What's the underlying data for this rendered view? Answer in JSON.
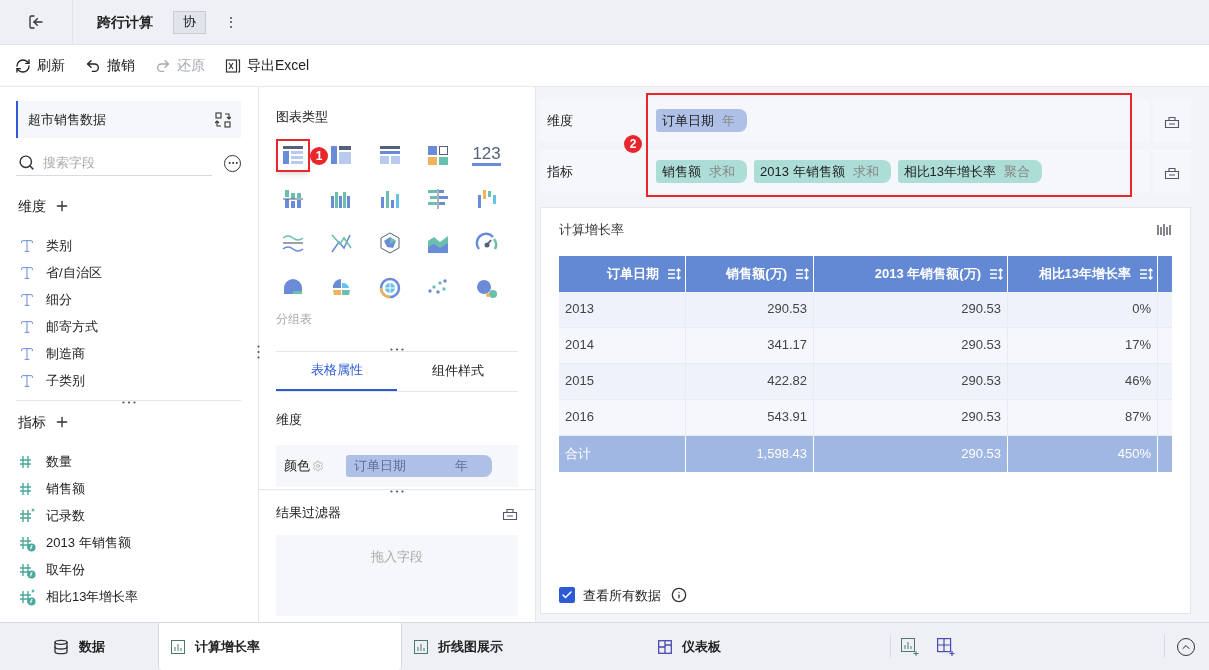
{
  "header": {
    "title": "跨行计算",
    "badge": "协",
    "more": "⋮"
  },
  "toolbar": [
    {
      "label": "刷新",
      "kind": "refresh",
      "disabled": false
    },
    {
      "label": "撤销",
      "kind": "undo",
      "disabled": false
    },
    {
      "label": "还原",
      "kind": "redo",
      "disabled": true
    },
    {
      "label": "导出Excel",
      "kind": "excel",
      "disabled": false
    }
  ],
  "dataset": {
    "name": "超市销售数据",
    "search_placeholder": "搜索字段"
  },
  "dimensions": {
    "title": "维度",
    "fields": [
      {
        "name": "类别",
        "kind": "text"
      },
      {
        "name": "省/自治区",
        "kind": "text"
      },
      {
        "name": "细分",
        "kind": "text"
      },
      {
        "name": "邮寄方式",
        "kind": "text"
      },
      {
        "name": "制造商",
        "kind": "text"
      },
      {
        "name": "子类别",
        "kind": "text"
      }
    ]
  },
  "measures": {
    "title": "指标",
    "fields": [
      {
        "name": "数量",
        "kind": "number"
      },
      {
        "name": "销售额",
        "kind": "number"
      },
      {
        "name": "记录数",
        "kind": "record"
      },
      {
        "name": "2013 年销售额",
        "kind": "calc"
      },
      {
        "name": "取年份",
        "kind": "calc"
      },
      {
        "name": "相比13年增长率",
        "kind": "calc-record"
      }
    ]
  },
  "chart_panel": {
    "title": "图表类型",
    "caption": "分组表",
    "types": [
      {
        "kind": "group-table",
        "selected": true
      },
      {
        "kind": "cross-table",
        "selected": false
      },
      {
        "kind": "detail-table",
        "selected": false
      },
      {
        "kind": "card",
        "selected": false
      },
      {
        "kind": "number",
        "text": "123",
        "selected": false
      },
      {
        "kind": "dot-bar",
        "selected": false
      },
      {
        "kind": "multi-bar",
        "selected": false
      },
      {
        "kind": "bar",
        "selected": false
      },
      {
        "kind": "hbar",
        "selected": false
      },
      {
        "kind": "float-bar",
        "selected": false
      },
      {
        "kind": "wave",
        "selected": false
      },
      {
        "kind": "line",
        "selected": false
      },
      {
        "kind": "radar",
        "selected": false
      },
      {
        "kind": "area",
        "selected": false
      },
      {
        "kind": "gauge",
        "selected": false
      },
      {
        "kind": "pie",
        "selected": false
      },
      {
        "kind": "rose",
        "selected": false
      },
      {
        "kind": "multi-pie",
        "selected": false
      },
      {
        "kind": "scatter",
        "selected": false
      },
      {
        "kind": "bubble",
        "selected": false
      }
    ]
  },
  "property_tabs": [
    {
      "label": "表格属性",
      "selected": true
    },
    {
      "label": "组件样式",
      "selected": false
    }
  ],
  "properties": {
    "section": "维度",
    "color_label": "颜色",
    "color_pill": {
      "name": "订单日期",
      "suffix": "年"
    }
  },
  "filter": {
    "title": "结果过滤器",
    "placeholder": "拖入字段"
  },
  "shelves": [
    {
      "label": "维度",
      "pills": [
        {
          "name": "订单日期",
          "suffix": "年",
          "kind": "dimension"
        }
      ]
    },
    {
      "label": "指标",
      "pills": [
        {
          "name": "销售额",
          "suffix": "求和",
          "kind": "measure"
        },
        {
          "name": "2013 年销售额",
          "suffix": "求和",
          "kind": "measure"
        },
        {
          "name": "相比13年增长率",
          "suffix": "聚合",
          "kind": "measure"
        }
      ]
    }
  ],
  "annotations": [
    {
      "label": "1"
    },
    {
      "label": "2"
    }
  ],
  "widget": {
    "title": "计算增长率",
    "table": {
      "columns": [
        "订单日期",
        "销售额(万)",
        "2013 年销售额(万)",
        "相比13年增长率"
      ],
      "rows": [
        [
          "2013",
          "290.53",
          "290.53",
          "0%"
        ],
        [
          "2014",
          "341.17",
          "290.53",
          "17%"
        ],
        [
          "2015",
          "422.82",
          "290.53",
          "46%"
        ],
        [
          "2016",
          "543.91",
          "290.53",
          "87%"
        ]
      ],
      "total": [
        "合计",
        "1,598.43",
        "290.53",
        "450%"
      ]
    },
    "view_all": {
      "label": "查看所有数据",
      "checked": true
    }
  },
  "bottom_tabs": [
    {
      "label": "数据",
      "kind": "data",
      "selected": false
    },
    {
      "label": "计算增长率",
      "kind": "chart",
      "selected": true
    },
    {
      "label": "折线图展示",
      "kind": "chart",
      "selected": false
    },
    {
      "label": "仪表板",
      "kind": "dashboard",
      "selected": false
    }
  ]
}
